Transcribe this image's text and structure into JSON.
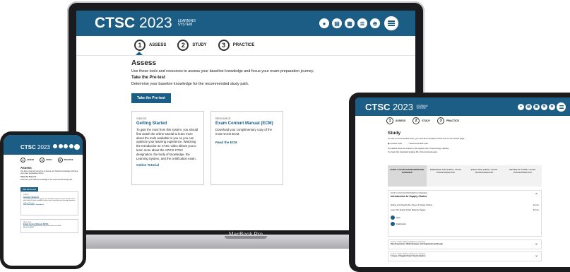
{
  "brand": {
    "name": "CTSC",
    "year": "2023",
    "sub1": "LEARNING",
    "sub2": "SYSTEM"
  },
  "nav_icons": [
    "profile-icon",
    "catalog-icon",
    "calendar-icon",
    "list-icon",
    "network-icon",
    "menu-icon"
  ],
  "steps": [
    {
      "num": "1",
      "label": "ASSESS"
    },
    {
      "num": "2",
      "label": "STUDY"
    },
    {
      "num": "3",
      "label": "PRACTICE"
    }
  ],
  "laptop": {
    "label": "MacBook Pro",
    "title": "Assess",
    "intro": "Use these tools and resources to assess your baseline knowledge and focus your exam preparation journey.",
    "pretest_heading": "Take the Pre-test",
    "pretest_desc": "Determine your baseline knowledge for the recommended study path.",
    "pretest_button": "Take the Pre-test",
    "card1": {
      "kicker": "VIDEOS",
      "title": "Getting Started",
      "body": "To gain the most from this system, you should first watch the online tutorial to learn more about the tools available to you so you can optimize your learning experience. Watching the Introduction to CTSC video allows you to learn more about the APICS CTSC designation, the body of knowledge, the Learning System, and the certification exam.",
      "link": "Online Tutorial"
    },
    "card2": {
      "kicker": "RESOURCE",
      "title": "Exam Content Manual (ECM)",
      "body": "Download your complimentary copy of the most recent ECM.",
      "link": "Read the ECM"
    }
  },
  "phone": {
    "title": "Assess",
    "intro": "Use these tools and resources to assess your baseline knowledge and focus your exam preparation journey.",
    "pretest_heading": "Take the Pre-test",
    "pretest_desc": "Determine your baseline knowledge for the recommended study path.",
    "pretest_button": "Take the Pre-test",
    "card1": {
      "kicker": "VIDEOS",
      "title": "Getting Started",
      "body": "To gain the most from this system, you should first watch the online tutorial to learn more about the tools available to you so you can optimize your learning experience.",
      "link1": "Online Tutorial",
      "link2": "Intro Messages / Guidelines"
    },
    "card2": {
      "kicker": "RESOURCE",
      "title": "Exam Content Manual (ECM)",
      "body": "Download your complimentary copy of the most recent ECM.",
      "link": "Read the ECM"
    }
  },
  "tablet": {
    "title": "Study",
    "intro": "To view a recommended order, you must first complete the Pre-test on the Assess page.",
    "radio1": "Content order",
    "radio2": "Recommended order",
    "line2": "The tabbed below are ordered in the original order of the learning materials.",
    "line3": "You have fully completed studying 0% of the functional areas.",
    "tabs": [
      "SUPPLY CHAIN TRANSFORMATION OVERVIEW",
      "PREPARING FOR SUPPLY CHAIN TRANSFORMATION",
      "EXECUTING SUPPLY CHAIN TRANSFORMATION",
      "REVIEW OF SUPPLY CHAIN TRANSFORMATION"
    ],
    "section1": {
      "kicker": "SUPPLY CHAIN TRANSFORMATION OVERVIEW",
      "title": "Introduction to Supply Chains"
    },
    "rows": [
      {
        "label": "Define and Classify the Types of Supply Chains",
        "time": "12 min"
      },
      {
        "label": "Learn the Supply Chain Maturity Stages",
        "time": "23 min"
      }
    ],
    "pills": [
      "Quiz",
      "Flashcards"
    ],
    "section2": {
      "kicker": "SUPPLY CHAIN TRANSFORMATION OVERVIEW",
      "title": "Data Preparation, Methodologies and Organizational Design"
    },
    "section3": {
      "kicker": "SUPPLY CHAIN TRANSFORMATION OVERVIEW",
      "title": "5 Areas of Supply Chain Transformation"
    }
  }
}
